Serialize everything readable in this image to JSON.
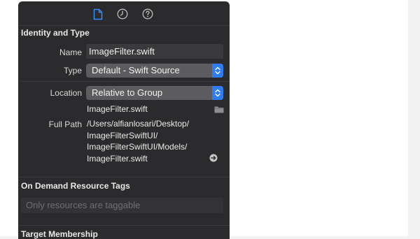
{
  "tabs": [
    {
      "name": "file-inspector",
      "icon": "document-icon",
      "active": true
    },
    {
      "name": "history-inspector",
      "icon": "clock-icon",
      "active": false
    },
    {
      "name": "quick-help",
      "icon": "help-icon",
      "active": false
    }
  ],
  "identity": {
    "title": "Identity and Type",
    "name_label": "Name",
    "name_value": "ImageFilter.swift",
    "type_label": "Type",
    "type_value": "Default - Swift Source",
    "location_label": "Location",
    "location_value": "Relative to Group",
    "file_name": "ImageFilter.swift",
    "full_path_label": "Full Path",
    "full_path_lines": [
      "/Users/alfianlosari/Desktop/",
      "ImageFilterSwiftUI/",
      "ImageFilterSwiftUI/Models/",
      "ImageFilter.swift"
    ]
  },
  "on_demand": {
    "title": "On Demand Resource Tags",
    "placeholder": "Only resources are taggable"
  },
  "target": {
    "title": "Target Membership"
  },
  "colors": {
    "panel_bg": "#2b2b2d",
    "accent": "#2f7df6",
    "active_tab": "#2f8cff"
  }
}
